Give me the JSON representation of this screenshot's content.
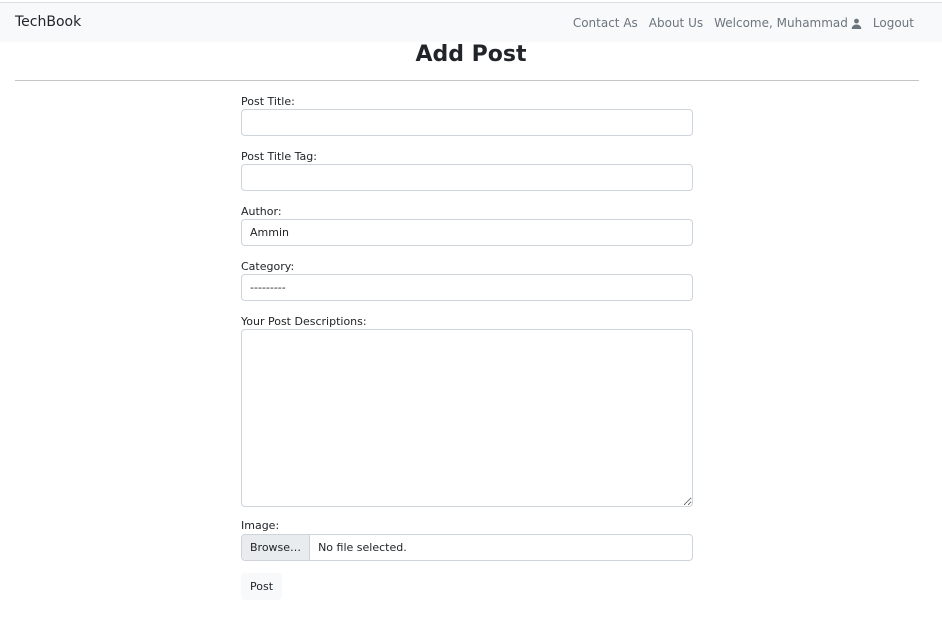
{
  "navbar": {
    "brand": "TechBook",
    "links": [
      "Contact As",
      "About Us"
    ],
    "welcome": "Welcome, Muhammad",
    "logout": "Logout"
  },
  "page": {
    "title": "Add Post"
  },
  "form": {
    "post_title_label": "Post Title:",
    "post_title_value": "",
    "title_tag_label": "Post Title Tag:",
    "title_tag_value": "",
    "author_label": "Author:",
    "author_value": "Ammin",
    "category_label": "Category:",
    "category_value": "---------",
    "description_label": "Your Post Descriptions:",
    "description_value": "",
    "image_label": "Image:",
    "browse_label": "Browse…",
    "file_status": "No file selected.",
    "submit_label": "Post"
  },
  "icons": {
    "user": "user-icon"
  },
  "colors": {
    "navbar_bg": "#f8f9fa",
    "nav_text": "#6c757d",
    "border": "#ced4da"
  }
}
